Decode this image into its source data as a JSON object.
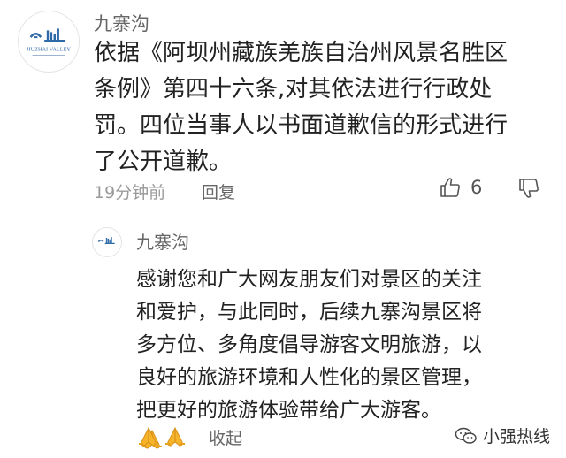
{
  "comment": {
    "author": "九寨沟",
    "avatar_text": "JIUZHAI VALLEY",
    "text_lines": [
      "依据《阿坝州藏族羌族自治州风景名胜区",
      "条例》第四十六条,对其依法进行行政处",
      "罚。四位当事人以书面道歉信的形式进行",
      "了公开道歉。"
    ],
    "time": "19分钟前",
    "reply_label": "回复",
    "like_count": "6"
  },
  "reply": {
    "author": "九寨沟",
    "text_lines": [
      "感谢您和广大网友朋友们对景区的关注",
      "和爱护，与此同时，后续九寨沟景区将",
      "多方位、多角度倡导游客文明旅游，以",
      "良好的旅游环境和人性化的景区管理，",
      "把更好的旅游体验带给广大游客。"
    ],
    "collapse_label": "收起"
  },
  "watermark": {
    "text": "小强热线"
  },
  "colors": {
    "text": "#222222",
    "meta": "#9a9a9a",
    "emoji": "#f6b42a"
  },
  "icons": {
    "like": "thumbs-up-icon",
    "dislike": "thumbs-down-icon",
    "emoji": "praying-hands-emoji",
    "watermark": "wechat-icon"
  }
}
